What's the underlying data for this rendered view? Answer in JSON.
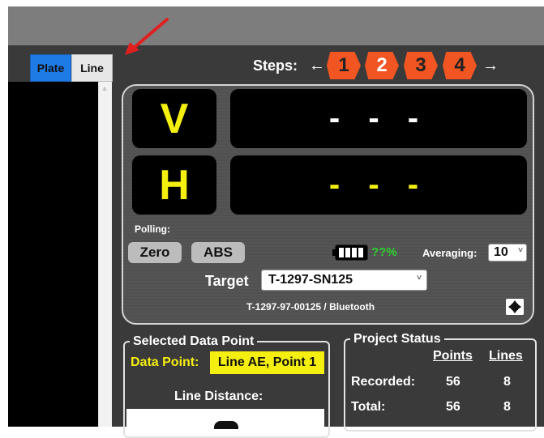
{
  "tabs": [
    {
      "label": "Plate",
      "active": true
    },
    {
      "label": "Line",
      "active": false
    }
  ],
  "steps": {
    "label": "Steps:",
    "prev_arrow": "←",
    "next_arrow": "→",
    "items": [
      "1",
      "2",
      "3",
      "4"
    ],
    "current": "2"
  },
  "readouts": {
    "v_label": "V",
    "v_value": "- - -",
    "h_label": "H",
    "h_value": "- - -"
  },
  "controls": {
    "polling_label": "Polling:",
    "zero_label": "Zero",
    "abs_label": "ABS",
    "battery_percent": "??%",
    "averaging_label": "Averaging:",
    "averaging_value": "10",
    "target_label": "Target",
    "target_value": "T-1297-SN125",
    "device_info": "T-1297-97-00125 / Bluetooth"
  },
  "selected_data_point": {
    "title": "Selected Data Point",
    "data_point_label": "Data Point:",
    "data_point_value": "Line AE, Point 1",
    "line_distance_label": "Line Distance:"
  },
  "project_status": {
    "title": "Project Status",
    "columns": [
      "Points",
      "Lines"
    ],
    "rows": [
      {
        "label": "Recorded:",
        "points": "56",
        "lines": "8"
      },
      {
        "label": "Total:",
        "points": "56",
        "lines": "8"
      }
    ]
  },
  "colors": {
    "accent_tab": "#1e7be6",
    "step_orange": "#f05522",
    "readout_yellow": "#f5ef10",
    "battery_green": "#2fd12f",
    "annotation_red": "#e02020"
  }
}
